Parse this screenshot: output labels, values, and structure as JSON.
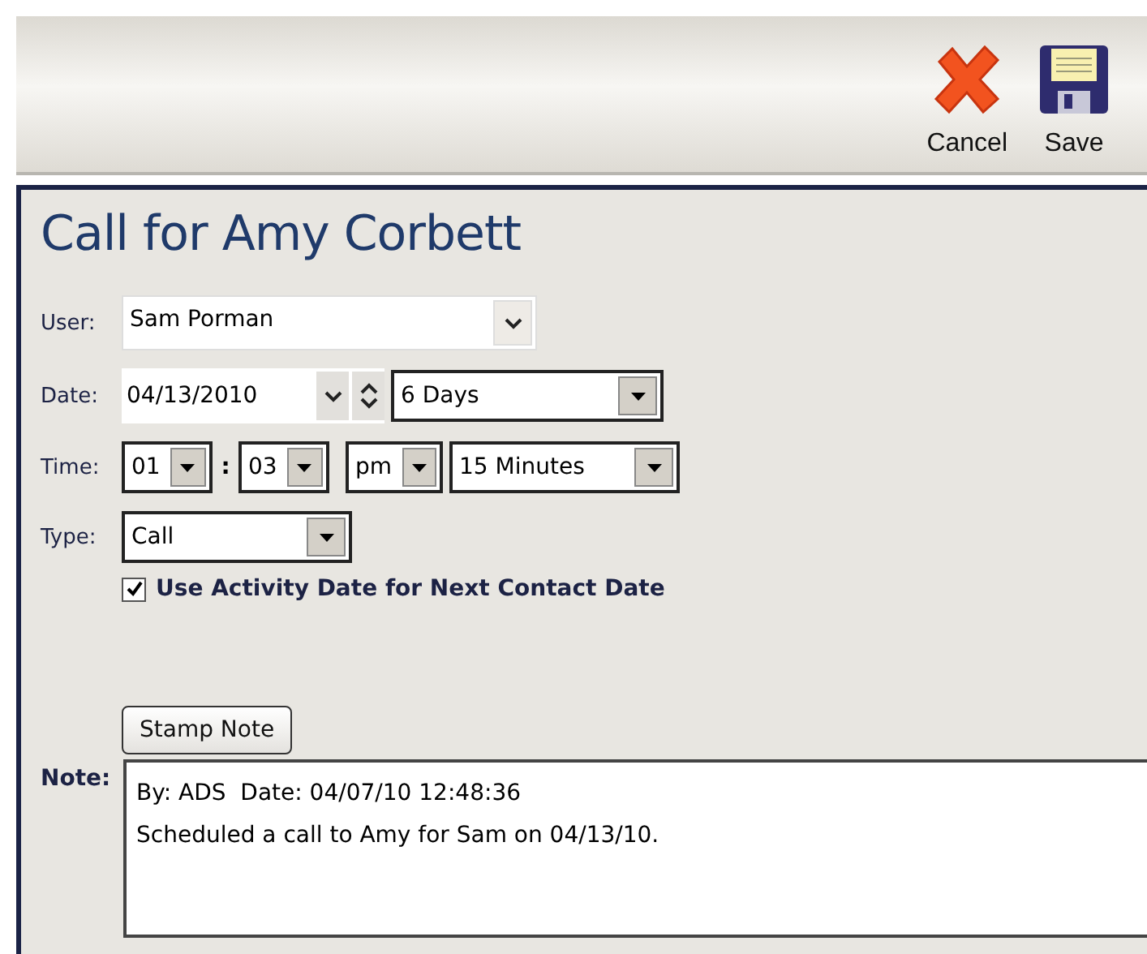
{
  "toolbar": {
    "buttons": [
      {
        "kind": "cancel",
        "label": "Cancel"
      },
      {
        "kind": "save",
        "label": "Save"
      }
    ]
  },
  "title": "Call for Amy Corbett",
  "form": {
    "user": {
      "label": "User:",
      "value": "Sam Porman"
    },
    "date": {
      "label": "Date:",
      "value": "04/13/2010",
      "period": "6 Days"
    },
    "time": {
      "label": "Time:",
      "hour": "01",
      "separator": ":",
      "minute": "03",
      "ampm": "pm",
      "duration": "15 Minutes"
    },
    "type": {
      "label": "Type:",
      "value": "Call"
    },
    "next_contact": {
      "label": "Use Activity Date for Next Contact Date",
      "checked": true
    },
    "stamp_button": "Stamp Note",
    "note": {
      "label": "Note:",
      "value": "By: ADS  Date: 04/07/10 12:48:36\nScheduled a call to Amy for Sam on 04/13/10."
    }
  }
}
